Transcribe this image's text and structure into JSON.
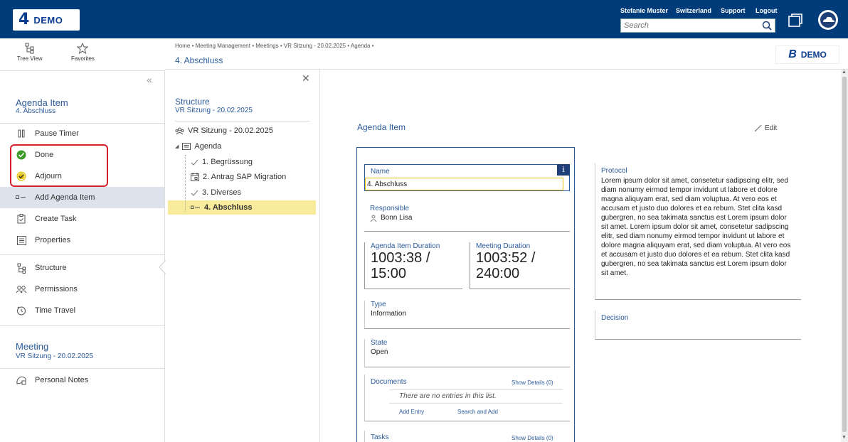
{
  "header": {
    "logo_mark": "4",
    "logo_text": "DEMO",
    "user": "Stefanie Muster",
    "region": "Switzerland",
    "support": "Support",
    "logout": "Logout",
    "search_placeholder": "Search"
  },
  "toolbar": {
    "tree_view": "Tree View",
    "favorites": "Favorites"
  },
  "sidebar": {
    "section1_title": "Agenda Item",
    "section1_sub": "4. Abschluss",
    "actions": [
      {
        "label": "Pause Timer",
        "icon": "pause-icon"
      },
      {
        "label": "Done",
        "icon": "check-green-icon"
      },
      {
        "label": "Adjourn",
        "icon": "check-yellow-icon"
      },
      {
        "label": "Add Agenda Item",
        "icon": "add-item-icon"
      },
      {
        "label": "Create Task",
        "icon": "clipboard-icon"
      },
      {
        "label": "Properties",
        "icon": "properties-icon"
      },
      {
        "label": "Structure",
        "icon": "structure-icon"
      },
      {
        "label": "Permissions",
        "icon": "permissions-icon"
      },
      {
        "label": "Time Travel",
        "icon": "clock-icon"
      }
    ],
    "section2_title": "Meeting",
    "section2_sub": "VR Sitzung - 20.02.2025",
    "personal_notes": "Personal Notes"
  },
  "content_header": {
    "breadcrumb": "Home  •  Meeting Management  •  Meetings  •  VR Sitzung - 20.02.2025  •  Agenda  •",
    "title": "4. Abschluss",
    "badge_b": "B",
    "badge_text": "DEMO"
  },
  "structure": {
    "title": "Structure",
    "sub": "VR Sitzung - 20.02.2025",
    "root": "VR Sitzung - 20.02.2025",
    "agenda": "Agenda",
    "items": [
      "1. Begrüssung",
      "2. Antrag SAP Migration",
      "3. Diverses",
      "4. Abschluss"
    ]
  },
  "agenda_item": {
    "title": "Agenda Item",
    "edit": "Edit",
    "name_label": "Name",
    "name_value": "4. Abschluss",
    "info": "i",
    "responsible_label": "Responsible",
    "responsible_value": "Bonn Lisa",
    "duration_label": "Agenda Item Duration",
    "duration_line1": "1003:38 /",
    "duration_line2": "15:00",
    "meeting_duration_label": "Meeting Duration",
    "meeting_duration_line1": "1003:52 /",
    "meeting_duration_line2": "240:00",
    "type_label": "Type",
    "type_value": "Information",
    "state_label": "State",
    "state_value": "Open",
    "documents_label": "Documents",
    "documents_show": "Show Details (0)",
    "documents_empty": "There are no entries in this list.",
    "add_entry": "Add Entry",
    "search_add": "Search and Add",
    "tasks_label": "Tasks",
    "tasks_show": "Show Details (0)",
    "protocol_label": "Protocol",
    "protocol_text": "Lorem ipsum dolor sit amet, consetetur sadipscing elitr, sed diam nonumy eirmod tempor invidunt ut labore et dolore magna aliquyam erat, sed diam voluptua. At vero eos et accusam et justo duo dolores et ea rebum. Stet clita kasd gubergren, no sea takimata sanctus est Lorem ipsum dolor sit amet. Lorem ipsum dolor sit amet, consetetur sadipscing elitr, sed diam nonumy eirmod tempor invidunt ut labore et dolore magna aliquyam erat, sed diam voluptua. At vero eos et accusam et justo duo dolores et ea rebum. Stet clita kasd gubergren, no sea takimata sanctus est Lorem ipsum dolor sit amet.",
    "decision_label": "Decision"
  },
  "colors": {
    "topbar": "#003b7a",
    "accent": "#2a5a9a",
    "highlight_red": "#d6202a",
    "selected_yellow": "#f9eb9c"
  }
}
